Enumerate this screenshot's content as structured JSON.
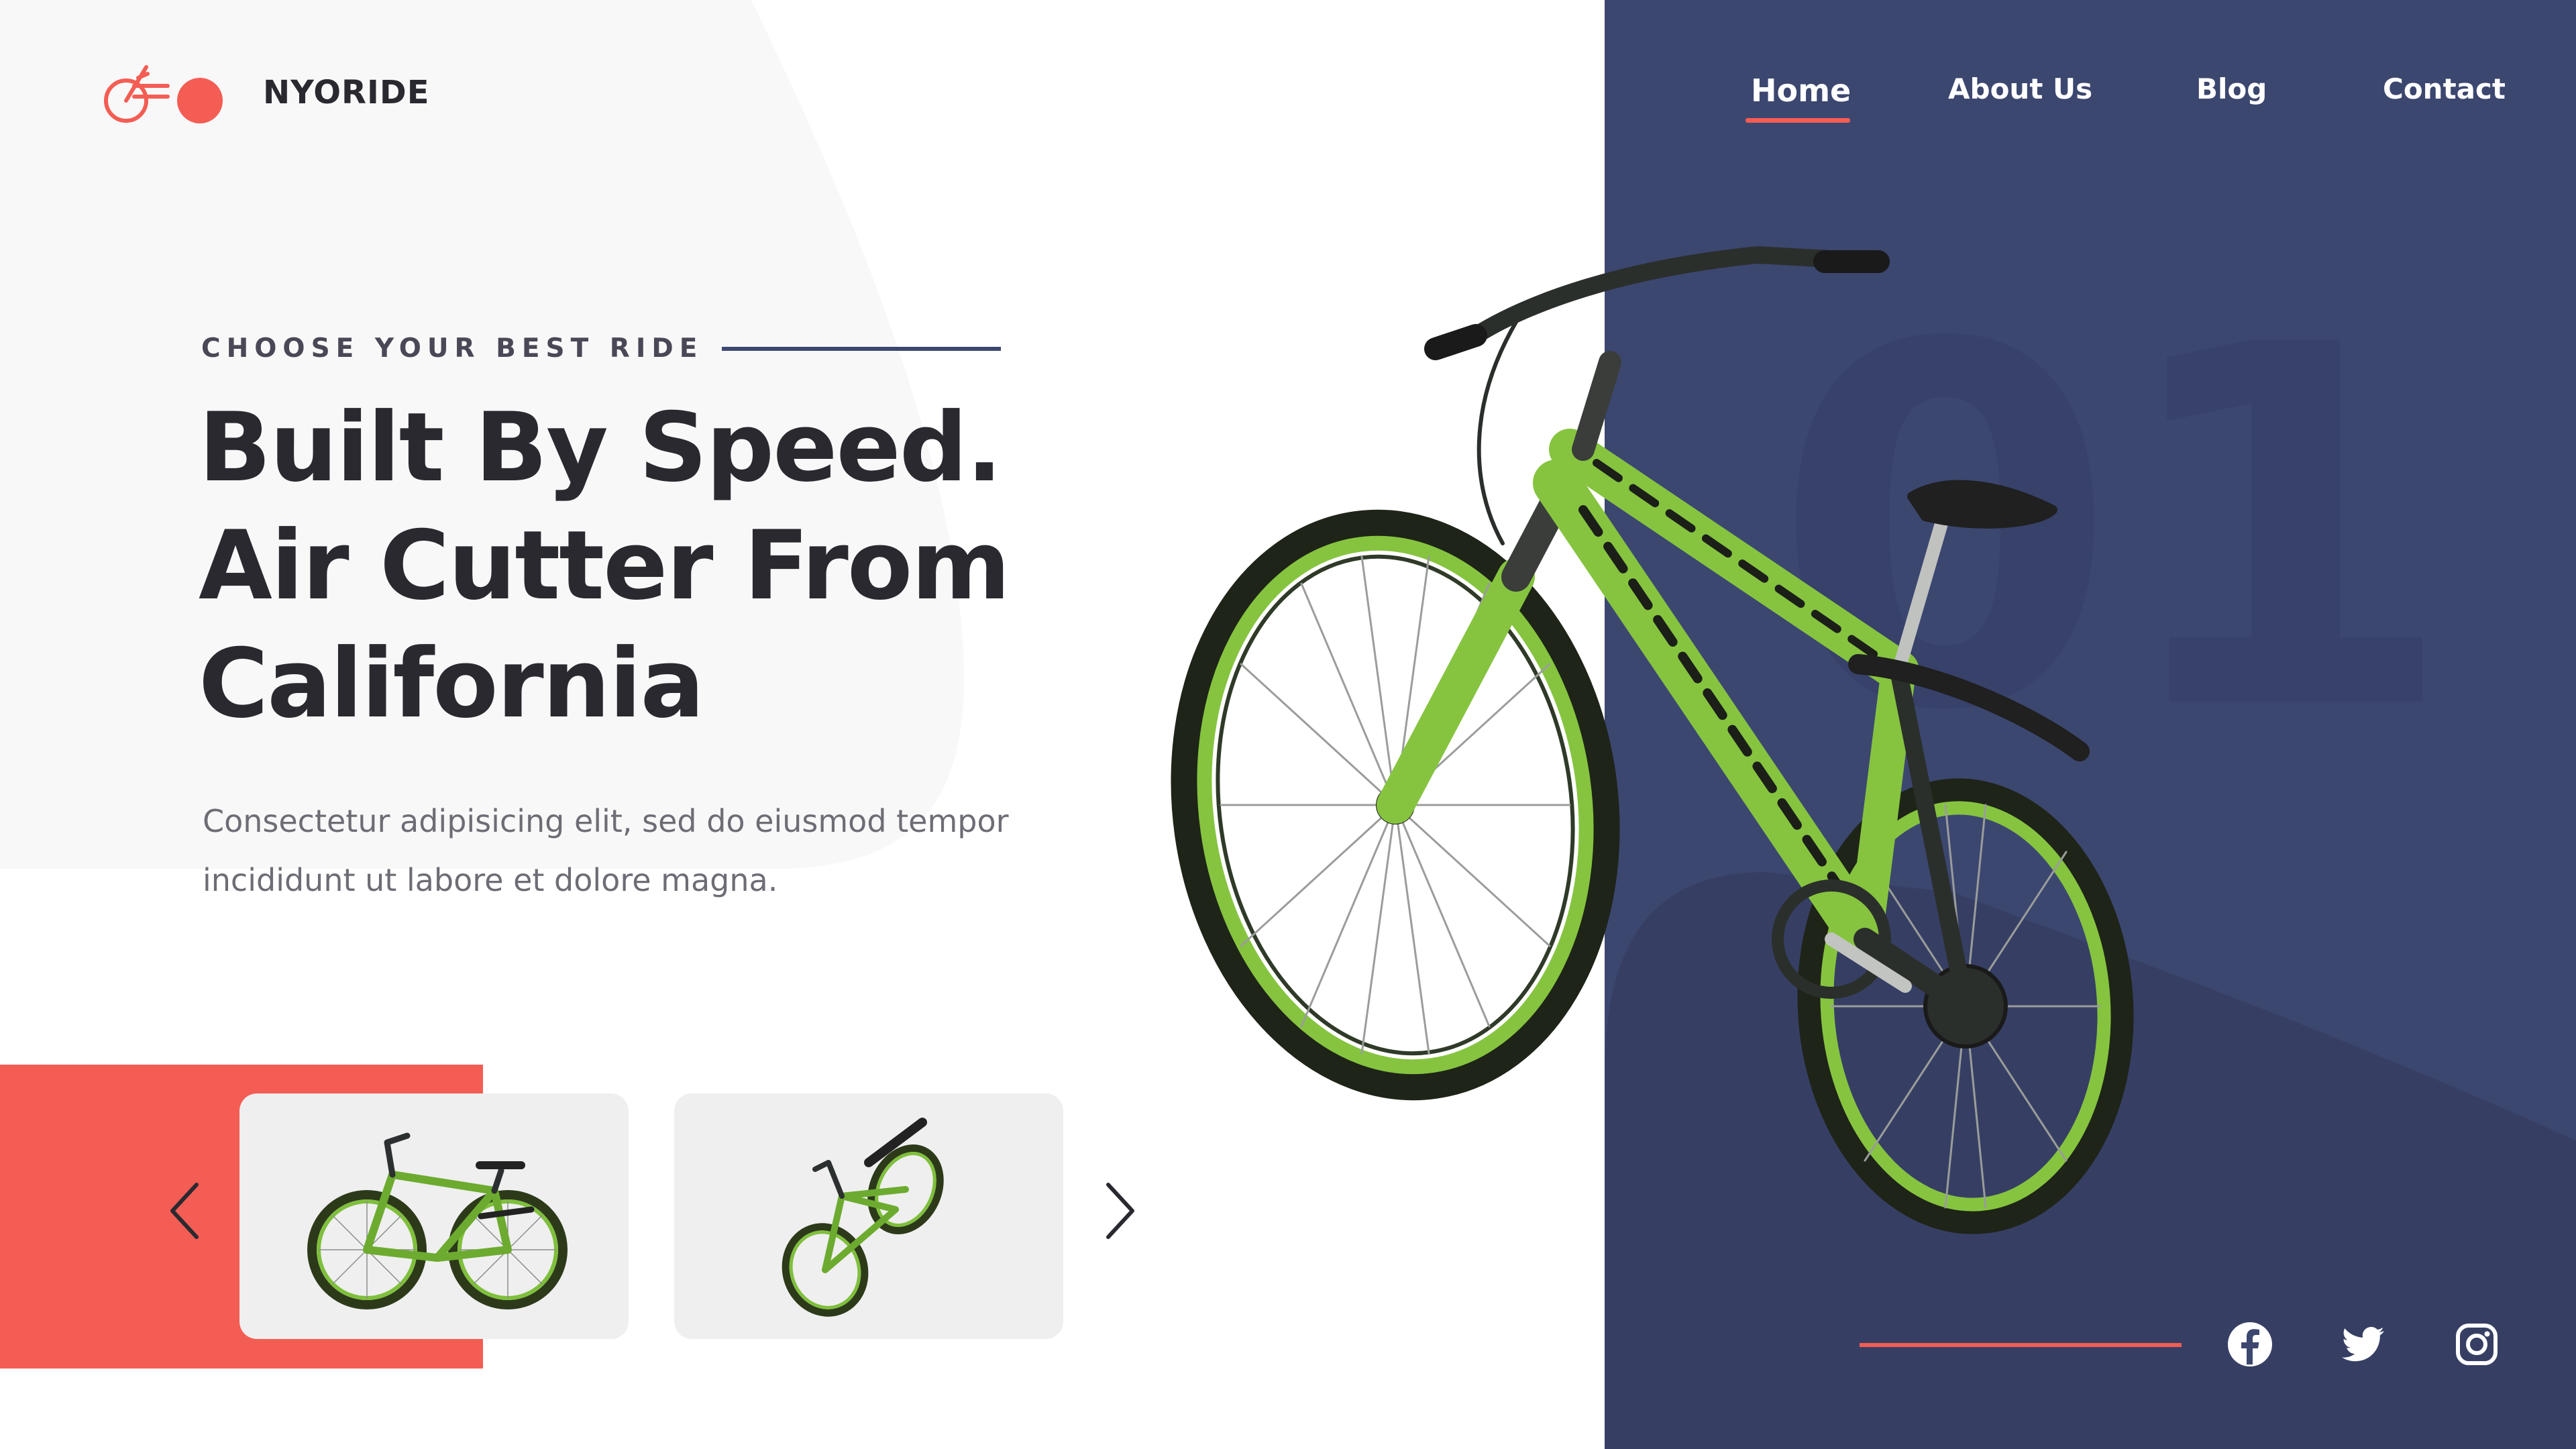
{
  "brand": {
    "name": "NYORIDE",
    "accent_color": "#f45d54",
    "panel_color": "#3c4770"
  },
  "nav": {
    "items": [
      {
        "label": "Home",
        "active": true
      },
      {
        "label": "About Us",
        "active": false
      },
      {
        "label": "Blog",
        "active": false
      },
      {
        "label": "Contact",
        "active": false
      }
    ]
  },
  "hero": {
    "eyebrow": "CHOOSE YOUR BEST RIDE",
    "headline_lines": [
      "Built By Speed.",
      "Air Cutter From",
      "California"
    ],
    "description_lines": [
      "Consectetur adipisicing elit, sed do eiusmod tempor",
      "incididunt ut labore et dolore magna."
    ],
    "slide_number": "01",
    "image": {
      "icon": "green-mountain-bike-image",
      "frame_color": "#86c440"
    }
  },
  "carousel": {
    "prev_icon": "chevron-left-icon",
    "next_icon": "chevron-right-icon",
    "thumbnails": [
      {
        "icon": "bike-side-view-thumbnail"
      },
      {
        "icon": "bike-angled-view-thumbnail"
      }
    ]
  },
  "social": [
    {
      "icon": "facebook-icon"
    },
    {
      "icon": "twitter-icon"
    },
    {
      "icon": "instagram-icon"
    }
  ]
}
